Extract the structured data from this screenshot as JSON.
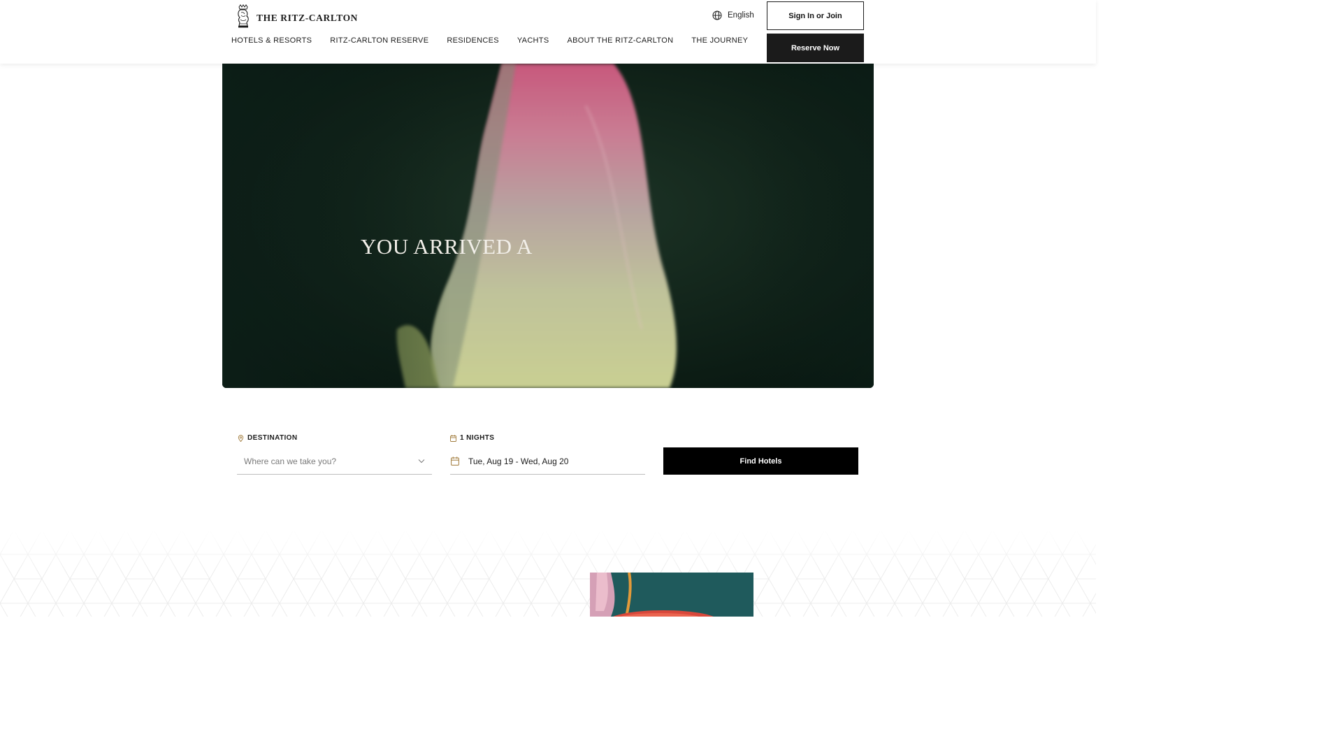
{
  "header": {
    "brand": "THE RITZ-CARLTON",
    "nav": [
      "HOTELS & RESORTS",
      "RITZ-CARLTON RESERVE",
      "RESIDENCES",
      "YACHTS",
      "ABOUT THE RITZ-CARLTON",
      "THE JOURNEY"
    ],
    "language": "English",
    "sign_in": "Sign In or Join",
    "reserve": "Reserve Now"
  },
  "hero": {
    "title": "YOU ARRIVED A"
  },
  "search": {
    "destination_label": "DESTINATION",
    "destination_placeholder": "Where can we take you?",
    "nights_label": "1 NIGHTS",
    "dates": "Tue, Aug 19 - Wed, Aug 20",
    "find_button": "Find Hotels"
  },
  "colors": {
    "accent_gold": "#a07a3a",
    "button_black": "#000000",
    "hero_bg": "#0d1f18"
  },
  "icons": {
    "logo": "lion-crown-icon",
    "language": "globe-icon",
    "destination": "map-pin-icon",
    "nights": "calendar-icon",
    "dropdown": "chevron-down-icon"
  }
}
